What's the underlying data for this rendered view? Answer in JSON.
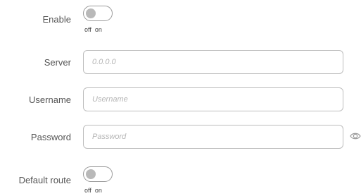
{
  "form": {
    "enable": {
      "label": "Enable",
      "off_label": "off",
      "on_label": "on",
      "state": "off"
    },
    "server": {
      "label": "Server",
      "value": "",
      "placeholder": "0.0.0.0"
    },
    "username": {
      "label": "Username",
      "value": "",
      "placeholder": "Username"
    },
    "password": {
      "label": "Password",
      "value": "",
      "placeholder": "Password",
      "reveal_icon": "eye-icon"
    },
    "default_route": {
      "label": "Default route",
      "off_label": "off",
      "on_label": "on",
      "state": "off"
    }
  },
  "colors": {
    "border": "#bdbdbd",
    "toggle_knob": "#b9b9b9",
    "placeholder": "#b5b5b5"
  }
}
